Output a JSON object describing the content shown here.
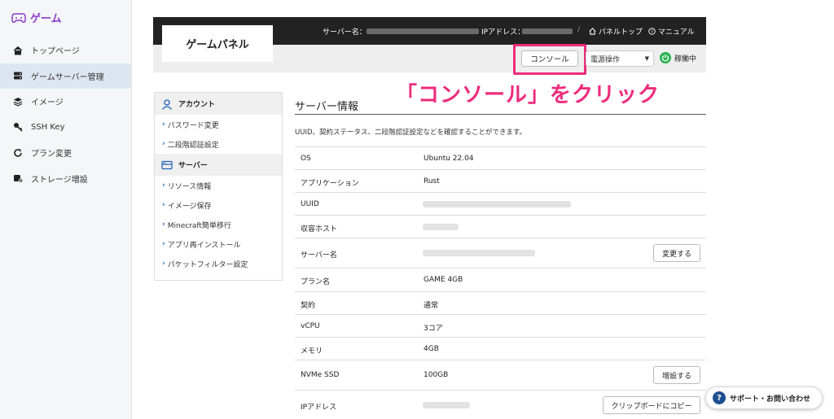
{
  "sidebar": {
    "brand": "ゲーム",
    "items": [
      {
        "label": "トップページ",
        "icon": "home-icon"
      },
      {
        "label": "ゲームサーバー管理",
        "icon": "server-icon"
      },
      {
        "label": "イメージ",
        "icon": "layers-icon"
      },
      {
        "label": "SSH Key",
        "icon": "key-icon"
      },
      {
        "label": "プラン変更",
        "icon": "refresh-icon"
      },
      {
        "label": "ストレージ増設",
        "icon": "storage-icon"
      }
    ],
    "active_index": 1
  },
  "header": {
    "panel_title": "ゲームパネル",
    "server_name_label": "サーバー名：",
    "ip_label": "IPアドレス：",
    "separator": "/",
    "panel_top_link": "パネルトップ",
    "manual_link": "マニュアル"
  },
  "toolbar": {
    "console_button": "コンソール",
    "power_select_value": "電源操作",
    "status_label": "稼働中"
  },
  "annotation": "「コンソール」をクリック",
  "menu": {
    "account_heading": "アカウント",
    "account_items": [
      "パスワード変更",
      "二段階認証設定"
    ],
    "server_heading": "サーバー",
    "server_items": [
      "リソース情報",
      "イメージ保存",
      "Minecraft簡単移行",
      "アプリ再インストール",
      "パケットフィルター設定"
    ]
  },
  "main": {
    "title": "サーバー情報",
    "description": "UUID、契約ステータス、二段階認証設定などを確認することができます。",
    "rows": [
      {
        "key": "OS",
        "value": "Ubuntu 22.04"
      },
      {
        "key": "アプリケーション",
        "value": "Rust"
      },
      {
        "key": "UUID",
        "value": ""
      },
      {
        "key": "収容ホスト",
        "value": ""
      },
      {
        "key": "サーバー名",
        "value": "",
        "button": "変更する"
      },
      {
        "key": "プラン名",
        "value": "GAME 4GB"
      },
      {
        "key": "契約",
        "value": "通常"
      },
      {
        "key": "vCPU",
        "value": "3コア"
      },
      {
        "key": "メモリ",
        "value": "4GB"
      },
      {
        "key": "NVMe SSD",
        "value": "100GB",
        "button": "増設する"
      },
      {
        "key": "IPアドレス",
        "value": "",
        "button": "クリップボードにコピー"
      }
    ]
  },
  "support": {
    "label": "サポート・お問い合わせ",
    "icon_text": "?"
  },
  "colors": {
    "accent": "#8a3cc7",
    "highlight": "#ee2b7d",
    "status": "#27b34c",
    "topbar": "#222222"
  }
}
